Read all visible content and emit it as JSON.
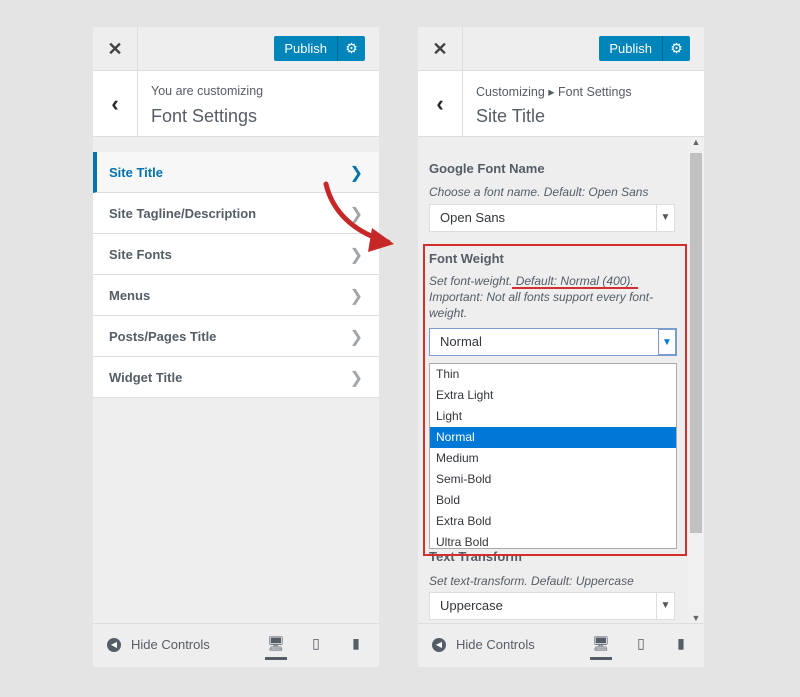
{
  "left_panel": {
    "close_icon": "close-icon",
    "publish_label": "Publish",
    "header_sub": "You are customizing",
    "header_title": "Font Settings",
    "menu_items": [
      {
        "label": "Site Title"
      },
      {
        "label": "Site Tagline/Description"
      },
      {
        "label": "Site Fonts"
      },
      {
        "label": "Menus"
      },
      {
        "label": "Posts/Pages Title"
      },
      {
        "label": "Widget Title"
      }
    ],
    "hide_controls": "Hide Controls"
  },
  "right_panel": {
    "publish_label": "Publish",
    "breadcrumb": "Customizing ▸ Font Settings",
    "header_title": "Site Title",
    "google_font": {
      "label": "Google Font Name",
      "description": "Choose a font name. Default: Open Sans",
      "value": "Open Sans"
    },
    "font_weight": {
      "label": "Font Weight",
      "description": "Set font-weight. Default: Normal (400). Important: Not all fonts support every font-weight.",
      "value": "Normal",
      "options": [
        "Thin",
        "Extra Light",
        "Light",
        "Normal",
        "Medium",
        "Semi-Bold",
        "Bold",
        "Extra Bold",
        "Ultra Bold"
      ],
      "selected_index": 3
    },
    "text_transform": {
      "label": "Text Transform",
      "description": "Set text-transform. Default: Uppercase",
      "value": "Uppercase"
    },
    "hide_controls": "Hide Controls"
  },
  "colors": {
    "accent": "#0085ba",
    "highlight": "#d32f2f",
    "selected_option": "#0078d7"
  }
}
